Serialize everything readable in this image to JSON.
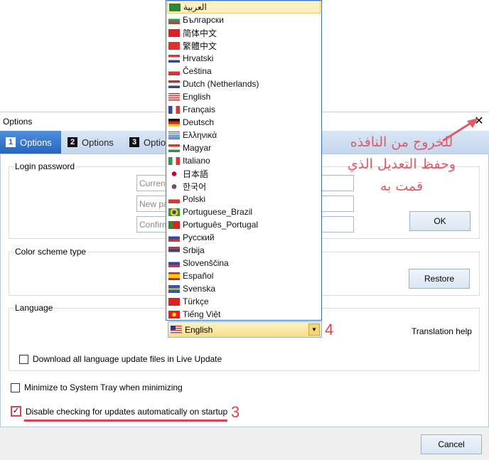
{
  "dialog": {
    "title": "Options",
    "close_icon": "close-icon",
    "tabs": [
      {
        "num": "1",
        "label": "Options",
        "active": true
      },
      {
        "num": "2",
        "label": "Options"
      },
      {
        "num": "3",
        "label": "Options"
      }
    ],
    "login": {
      "label": "Login password",
      "fields": [
        {
          "placeholder": "Current password"
        },
        {
          "placeholder": "New password"
        },
        {
          "placeholder": "Confirm password"
        }
      ],
      "ok": "OK"
    },
    "color": {
      "label": "Color scheme type",
      "restore": "Restore"
    },
    "language": {
      "label": "Language",
      "selected": "English",
      "translation_help": "Translation help",
      "download_all": "Download all language update files in Live Update",
      "download_all_checked": false
    },
    "minimize": {
      "label": "Minimize to System Tray when minimizing",
      "checked": false
    },
    "disable_updates": {
      "label": "Disable checking for updates automatically on startup",
      "checked": true
    },
    "cancel": "Cancel"
  },
  "dropdown": {
    "items": [
      "العربية",
      "Български",
      "简体中文",
      "繁體中文",
      "Hrvatski",
      "Čeština",
      "Dutch (Netherlands)",
      "English",
      "Français",
      "Deutsch",
      "Ελληνικά",
      "Magyar",
      "Italiano",
      "日本語",
      "한국어",
      "Polski",
      "Portuguese_Brazil",
      "Português_Portugal",
      "Русский",
      "Srbija",
      "Slovenščina",
      "Español",
      "Svenska",
      "Türkçe",
      "Tiếng Việt"
    ],
    "highlighted": 0
  },
  "annotations": {
    "step3": "3",
    "step4": "4",
    "arabic": [
      "للخروج من النافذه",
      "وحفظ التعديل الذي",
      "قمت به"
    ],
    "color": "#e04050"
  }
}
